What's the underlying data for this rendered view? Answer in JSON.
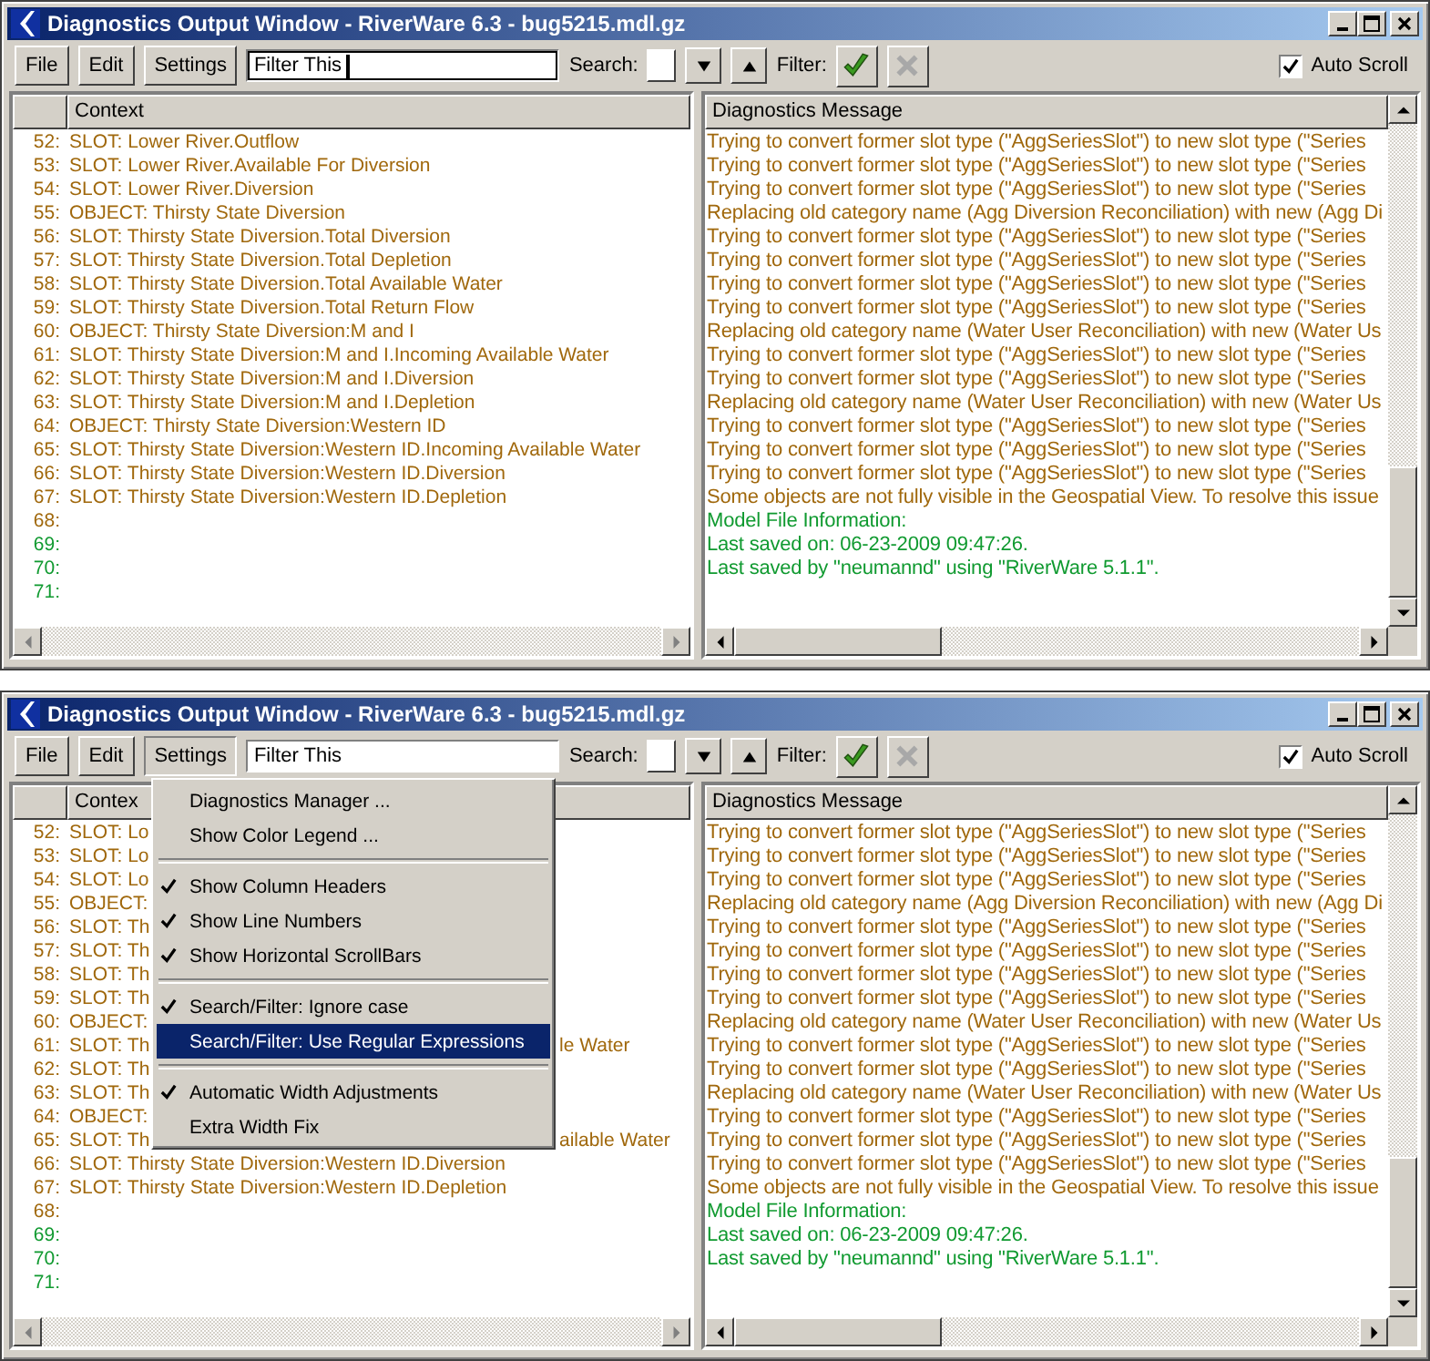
{
  "windows": [
    {
      "title": "Diagnostics Output Window - RiverWare 6.3 - bug5215.mdl.gz",
      "toolbar": {
        "menus": [
          {
            "label": "File",
            "pressed": false
          },
          {
            "label": "Edit",
            "pressed": false
          },
          {
            "label": "Settings",
            "pressed": false
          }
        ],
        "filter": {
          "value": "Filter This",
          "focused": true
        },
        "search_label": "Search:",
        "filter_label": "Filter:",
        "filter_buttons": [
          {
            "kind": "apply",
            "disabled": false
          },
          {
            "kind": "clear",
            "disabled": true
          }
        ],
        "auto_scroll": {
          "label": "Auto Scroll",
          "checked": true
        }
      },
      "context": {
        "heading": "Context",
        "rows": [
          {
            "number": "52:",
            "text": "SLOT: Lower River.Outflow",
            "color": "#a0680c"
          },
          {
            "number": "53:",
            "text": "SLOT: Lower River.Available For Diversion",
            "color": "#a0680c"
          },
          {
            "number": "54:",
            "text": "SLOT: Lower River.Diversion",
            "color": "#a0680c"
          },
          {
            "number": "55:",
            "text": "OBJECT: Thirsty State Diversion",
            "color": "#a0680c"
          },
          {
            "number": "56:",
            "text": "SLOT: Thirsty State Diversion.Total Diversion",
            "color": "#a0680c"
          },
          {
            "number": "57:",
            "text": "SLOT: Thirsty State Diversion.Total Depletion",
            "color": "#a0680c"
          },
          {
            "number": "58:",
            "text": "SLOT: Thirsty State Diversion.Total Available Water",
            "color": "#a0680c"
          },
          {
            "number": "59:",
            "text": "SLOT: Thirsty State Diversion.Total Return Flow",
            "color": "#a0680c"
          },
          {
            "number": "60:",
            "text": "OBJECT: Thirsty State Diversion:M and I",
            "color": "#a0680c"
          },
          {
            "number": "61:",
            "text": "SLOT: Thirsty State Diversion:M and I.Incoming Available Water",
            "color": "#a0680c"
          },
          {
            "number": "62:",
            "text": "SLOT: Thirsty State Diversion:M and I.Diversion",
            "color": "#a0680c"
          },
          {
            "number": "63:",
            "text": "SLOT: Thirsty State Diversion:M and I.Depletion",
            "color": "#a0680c"
          },
          {
            "number": "64:",
            "text": "OBJECT: Thirsty State Diversion:Western ID",
            "color": "#a0680c"
          },
          {
            "number": "65:",
            "text": "SLOT: Thirsty State Diversion:Western ID.Incoming Available Water",
            "color": "#a0680c"
          },
          {
            "number": "66:",
            "text": "SLOT: Thirsty State Diversion:Western ID.Diversion",
            "color": "#a0680c"
          },
          {
            "number": "67:",
            "text": "SLOT: Thirsty State Diversion:Western ID.Depletion",
            "color": "#a0680c"
          },
          {
            "number": "68:",
            "color": "#a0680c"
          },
          {
            "number": "69:",
            "color": "#109a30"
          },
          {
            "number": "70:",
            "color": "#109a30"
          },
          {
            "number": "71:",
            "color": "#109a30"
          }
        ]
      },
      "messages": {
        "heading": "Diagnostics Message",
        "rows": [
          {
            "text": "Trying to convert former slot type (\"AggSeriesSlot\") to new slot type (\"Series",
            "color": "#a0680c"
          },
          {
            "text": "Trying to convert former slot type (\"AggSeriesSlot\") to new slot type (\"Series",
            "color": "#a0680c"
          },
          {
            "text": "Trying to convert former slot type (\"AggSeriesSlot\") to new slot type (\"Series",
            "color": "#a0680c"
          },
          {
            "text": "Replacing old category name (Agg Diversion Reconciliation) with new (Agg Di",
            "color": "#a0680c"
          },
          {
            "text": "Trying to convert former slot type (\"AggSeriesSlot\") to new slot type (\"Series",
            "color": "#a0680c"
          },
          {
            "text": "Trying to convert former slot type (\"AggSeriesSlot\") to new slot type (\"Series",
            "color": "#a0680c"
          },
          {
            "text": "Trying to convert former slot type (\"AggSeriesSlot\") to new slot type (\"Series",
            "color": "#a0680c"
          },
          {
            "text": "Trying to convert former slot type (\"AggSeriesSlot\") to new slot type (\"Series",
            "color": "#a0680c"
          },
          {
            "text": "Replacing old category name (Water User Reconciliation) with new (Water Us",
            "color": "#a0680c"
          },
          {
            "text": "Trying to convert former slot type (\"AggSeriesSlot\") to new slot type (\"Series",
            "color": "#a0680c"
          },
          {
            "text": "Trying to convert former slot type (\"AggSeriesSlot\") to new slot type (\"Series",
            "color": "#a0680c"
          },
          {
            "text": "Replacing old category name (Water User Reconciliation) with new (Water Us",
            "color": "#a0680c"
          },
          {
            "text": "Trying to convert former slot type (\"AggSeriesSlot\") to new slot type (\"Series",
            "color": "#a0680c"
          },
          {
            "text": "Trying to convert former slot type (\"AggSeriesSlot\") to new slot type (\"Series",
            "color": "#a0680c"
          },
          {
            "text": "Trying to convert former slot type (\"AggSeriesSlot\") to new slot type (\"Series",
            "color": "#a0680c"
          },
          {
            "text": "Some objects are not fully visible in the Geospatial View. To resolve this issue",
            "color": "#a0680c"
          },
          {
            "text": "Model File Information:",
            "color": "#109a30"
          },
          {
            "text": "Last saved on: 06-23-2009 09:47:26.",
            "color": "#109a30"
          },
          {
            "text": "Last saved by \"neumannd\" using \"RiverWare 5.1.1\".",
            "color": "#109a30"
          }
        ]
      }
    },
    {
      "title": "Diagnostics Output Window - RiverWare 6.3 - bug5215.mdl.gz",
      "toolbar": {
        "menus": [
          {
            "label": "File",
            "pressed": false
          },
          {
            "label": "Edit",
            "pressed": false
          },
          {
            "label": "Settings",
            "pressed": true
          }
        ],
        "filter": {
          "value": "Filter This",
          "focused": false
        },
        "search_label": "Search:",
        "filter_label": "Filter:",
        "filter_buttons": [
          {
            "kind": "apply",
            "disabled": false
          },
          {
            "kind": "clear",
            "disabled": true
          }
        ],
        "auto_scroll": {
          "label": "Auto Scroll",
          "checked": true
        }
      },
      "context": {
        "heading": "Contex",
        "rows": [
          {
            "number": "52:",
            "text": "SLOT: Lo",
            "color": "#a0680c"
          },
          {
            "number": "53:",
            "text": "SLOT: Lo",
            "color": "#a0680c"
          },
          {
            "number": "54:",
            "text": "SLOT: Lo",
            "color": "#a0680c"
          },
          {
            "number": "55:",
            "text": "OBJECT:",
            "color": "#a0680c"
          },
          {
            "number": "56:",
            "text": "SLOT: Th",
            "color": "#a0680c"
          },
          {
            "number": "57:",
            "text": "SLOT: Th",
            "color": "#a0680c"
          },
          {
            "number": "58:",
            "text": "SLOT: Th",
            "color": "#a0680c"
          },
          {
            "number": "59:",
            "text": "SLOT: Th",
            "color": "#a0680c"
          },
          {
            "number": "60:",
            "text": "OBJECT:",
            "color": "#a0680c"
          },
          {
            "number": "61:",
            "text": "SLOT: Th",
            "tail": "le Water",
            "color": "#a0680c"
          },
          {
            "number": "62:",
            "text": "SLOT: Th",
            "color": "#a0680c"
          },
          {
            "number": "63:",
            "text": "SLOT: Th",
            "color": "#a0680c"
          },
          {
            "number": "64:",
            "text": "OBJECT:",
            "color": "#a0680c"
          },
          {
            "number": "65:",
            "text": "SLOT: Th",
            "tail": "ailable Water",
            "color": "#a0680c"
          },
          {
            "number": "66:",
            "text": "SLOT: Thirsty State Diversion:Western ID.Diversion",
            "color": "#a0680c"
          },
          {
            "number": "67:",
            "text": "SLOT: Thirsty State Diversion:Western ID.Depletion",
            "color": "#a0680c"
          },
          {
            "number": "68:",
            "color": "#a0680c"
          },
          {
            "number": "69:",
            "color": "#109a30"
          },
          {
            "number": "70:",
            "color": "#109a30"
          },
          {
            "number": "71:",
            "color": "#109a30"
          }
        ]
      },
      "messages": {
        "heading": "Diagnostics Message",
        "rows": [
          {
            "text": "Trying to convert former slot type (\"AggSeriesSlot\") to new slot type (\"Series",
            "color": "#a0680c"
          },
          {
            "text": "Trying to convert former slot type (\"AggSeriesSlot\") to new slot type (\"Series",
            "color": "#a0680c"
          },
          {
            "text": "Trying to convert former slot type (\"AggSeriesSlot\") to new slot type (\"Series",
            "color": "#a0680c"
          },
          {
            "text": "Replacing old category name (Agg Diversion Reconciliation) with new (Agg Di",
            "color": "#a0680c"
          },
          {
            "text": "Trying to convert former slot type (\"AggSeriesSlot\") to new slot type (\"Series",
            "color": "#a0680c"
          },
          {
            "text": "Trying to convert former slot type (\"AggSeriesSlot\") to new slot type (\"Series",
            "color": "#a0680c"
          },
          {
            "text": "Trying to convert former slot type (\"AggSeriesSlot\") to new slot type (\"Series",
            "color": "#a0680c"
          },
          {
            "text": "Trying to convert former slot type (\"AggSeriesSlot\") to new slot type (\"Series",
            "color": "#a0680c"
          },
          {
            "text": "Replacing old category name (Water User Reconciliation) with new (Water Us",
            "color": "#a0680c"
          },
          {
            "text": "Trying to convert former slot type (\"AggSeriesSlot\") to new slot type (\"Series",
            "color": "#a0680c"
          },
          {
            "text": "Trying to convert former slot type (\"AggSeriesSlot\") to new slot type (\"Series",
            "color": "#a0680c"
          },
          {
            "text": "Replacing old category name (Water User Reconciliation) with new (Water Us",
            "color": "#a0680c"
          },
          {
            "text": "Trying to convert former slot type (\"AggSeriesSlot\") to new slot type (\"Series",
            "color": "#a0680c"
          },
          {
            "text": "Trying to convert former slot type (\"AggSeriesSlot\") to new slot type (\"Series",
            "color": "#a0680c"
          },
          {
            "text": "Trying to convert former slot type (\"AggSeriesSlot\") to new slot type (\"Series",
            "color": "#a0680c"
          },
          {
            "text": "Some objects are not fully visible in the Geospatial View. To resolve this issue",
            "color": "#a0680c"
          },
          {
            "text": "Model File Information:",
            "color": "#109a30"
          },
          {
            "text": "Last saved on: 06-23-2009 09:47:26.",
            "color": "#109a30"
          },
          {
            "text": "Last saved by \"neumannd\" using \"RiverWare 5.1.1\".",
            "color": "#109a30"
          }
        ]
      },
      "menu": {
        "items": [
          {
            "kind": "item",
            "label": "Diagnostics Manager ...",
            "checked": false,
            "selected": false
          },
          {
            "kind": "item",
            "label": "Show Color Legend ...",
            "checked": false,
            "selected": false
          },
          {
            "kind": "separator"
          },
          {
            "kind": "item",
            "label": "Show Column Headers",
            "checked": true,
            "selected": false
          },
          {
            "kind": "item",
            "label": "Show Line Numbers",
            "checked": true,
            "selected": false
          },
          {
            "kind": "item",
            "label": "Show Horizontal ScrollBars",
            "checked": true,
            "selected": false
          },
          {
            "kind": "separator"
          },
          {
            "kind": "item",
            "label": "Search/Filter: Ignore case",
            "checked": true,
            "selected": false
          },
          {
            "kind": "item",
            "label": "Search/Filter: Use Regular Expressions",
            "checked": false,
            "selected": true
          },
          {
            "kind": "separator"
          },
          {
            "kind": "item",
            "label": "Automatic Width Adjustments",
            "checked": true,
            "selected": false
          },
          {
            "kind": "item",
            "label": "Extra Width Fix",
            "checked": false,
            "selected": false
          }
        ]
      }
    }
  ]
}
